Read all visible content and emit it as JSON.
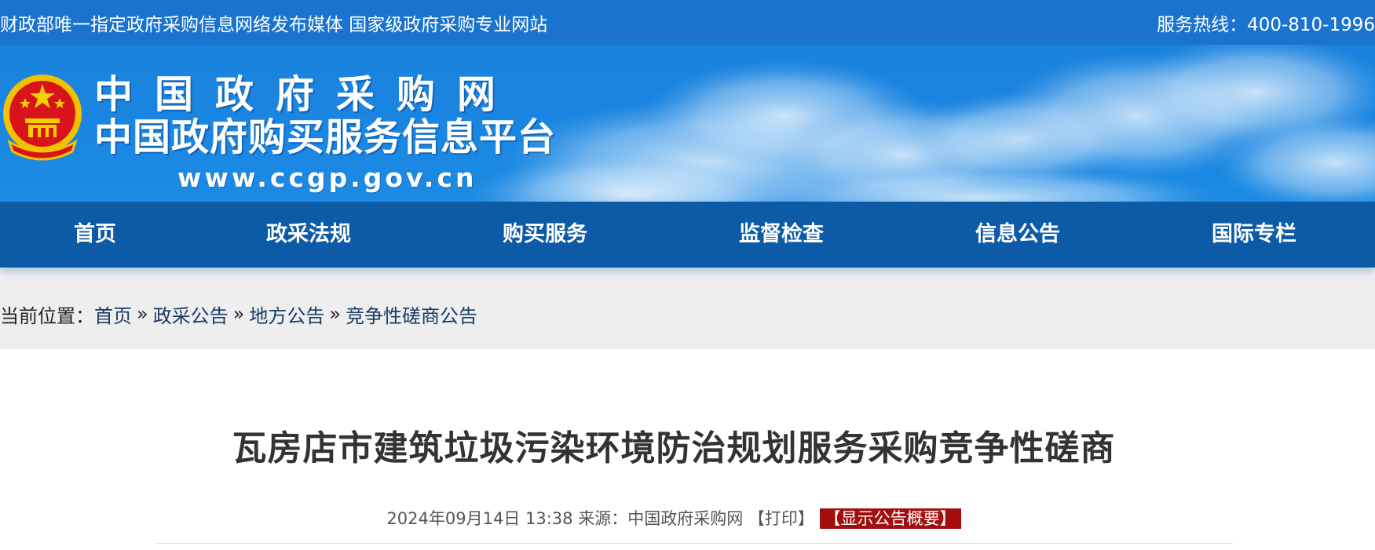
{
  "top_strip": {
    "slogan": "财政部唯一指定政府采购信息网络发布媒体 国家级政府采购专业网站",
    "hotline": "服务热线：400-810-1996"
  },
  "banner": {
    "site_name": "中国政府采购网",
    "site_subtitle": "中国政府购买服务信息平台",
    "site_url": "www.ccgp.gov.cn"
  },
  "nav": {
    "items": [
      {
        "label": "首页"
      },
      {
        "label": "政采法规"
      },
      {
        "label": "购买服务"
      },
      {
        "label": "监督检查"
      },
      {
        "label": "信息公告"
      },
      {
        "label": "国际专栏"
      }
    ]
  },
  "breadcrumb": {
    "prefix": "当前位置：",
    "items": [
      "首页",
      "政采公告",
      "地方公告",
      "竞争性磋商公告"
    ],
    "separator": "»"
  },
  "article": {
    "title": "瓦房店市建筑垃圾污染环境防治规划服务采购竞争性磋商",
    "datetime": "2024年09月14日 13:38",
    "source_label": "来源：",
    "source": "中国政府采购网",
    "print_label": "【打印】",
    "summary_label": "【显示公告概要】"
  },
  "colors": {
    "top_strip_bg": "#1a74cf",
    "banner_bg": "#1a86e2",
    "nav_bg": "#0d5aa7",
    "summary_badge_bg": "#a30d0d"
  },
  "icons": {
    "emblem": "national-emblem-icon"
  }
}
